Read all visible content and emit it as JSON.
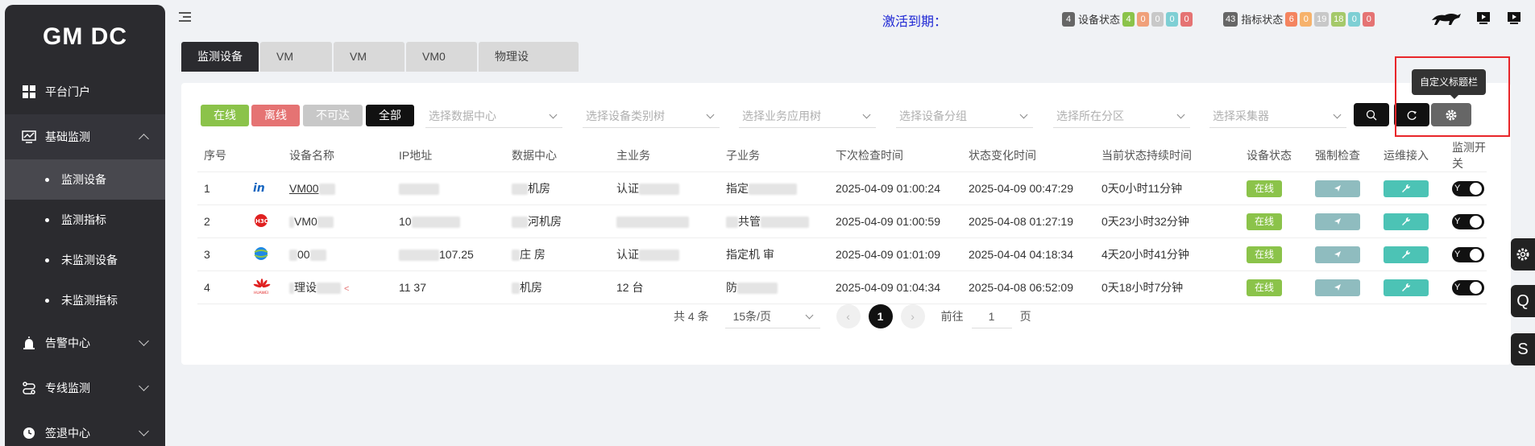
{
  "app": {
    "logo": "GM DC"
  },
  "sidebar": {
    "portal": "平台门户",
    "basic": "基础监测",
    "subs": [
      "监测设备",
      "监测指标",
      "未监测设备",
      "未监测指标"
    ],
    "alarm": "告警中心",
    "line": "专线监测",
    "sign": "签退中心"
  },
  "header": {
    "activation": "激活到期：",
    "devstat": {
      "count": "4",
      "label": "设备状态",
      "badges": [
        "4",
        "0",
        "0",
        "0",
        "0"
      ]
    },
    "idxstat": {
      "count": "43",
      "label": "指标状态",
      "badges": [
        "6",
        "0",
        "19",
        "18",
        "0",
        "0"
      ]
    }
  },
  "tabs": [
    "监测设备",
    "VM",
    "VM",
    "VM0",
    "物理设"
  ],
  "filters": {
    "online": "在线",
    "offline": "离线",
    "unreach": "不可达",
    "all": "全部"
  },
  "selects": [
    "选择数据中心",
    "选择设备类别树",
    "选择业务应用树",
    "选择设备分组",
    "选择所在分区",
    "选择采集器"
  ],
  "tooltip": "自定义标题栏",
  "table": {
    "headers": [
      "序号",
      "",
      "设备名称",
      "IP地址",
      "数据中心",
      "主业务",
      "子业务",
      "下次检查时间",
      "状态变化时间",
      "当前状态持续时间",
      "设备状态",
      "强制检查",
      "运维接入",
      "监测开关"
    ],
    "rows": [
      {
        "no": "1",
        "name": "VM00",
        "ip": "",
        "dc": "机房",
        "main": "认证",
        "sub": "指定",
        "next": "2025-04-09 01:00:24",
        "change": "2025-04-09 00:47:29",
        "dur": "0天0小时11分钟",
        "status": "在线",
        "sw": "Y"
      },
      {
        "no": "2",
        "name": "VM0",
        "ip": "10",
        "dc": "河机房",
        "main": "",
        "sub": "共管",
        "next": "2025-04-09 01:00:59",
        "change": "2025-04-08 01:27:19",
        "dur": "0天23小时32分钟",
        "status": "在线",
        "sw": "Y"
      },
      {
        "no": "3",
        "name": "00",
        "ip": "107.25",
        "dc": "庄 房",
        "main": "认证",
        "sub": "指定机 审",
        "next": "2025-04-09 01:01:09",
        "change": "2025-04-04 04:18:34",
        "dur": "4天20小时41分钟",
        "status": "在线",
        "sw": "Y"
      },
      {
        "no": "4",
        "name": "理设",
        "ip": "11 37",
        "dc": "机房",
        "main": "12 台",
        "sub": "防",
        "next": "2025-04-09 01:04:34",
        "change": "2025-04-08 06:52:09",
        "dur": "0天18小时7分钟",
        "status": "在线",
        "sw": "Y"
      }
    ]
  },
  "pager": {
    "total": "共 4 条",
    "size": "15条/页",
    "current": "1",
    "goto": "前往",
    "page": "1",
    "unit": "页"
  },
  "right_tabs": [
    "Q",
    "S"
  ]
}
